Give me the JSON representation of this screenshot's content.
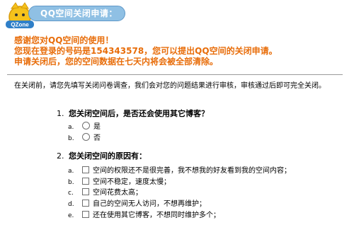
{
  "header": {
    "logo_text": "QZone",
    "title": "QQ空间关闭申请："
  },
  "notice": {
    "line1": "感谢您对QQ空间的使用！",
    "line2_prefix": "您现在登录的号码是",
    "qq_number": "154343578",
    "line2_suffix": "，您可以提出QQ空间的关闭申请。",
    "line3": "申请关闭后，您的空间数据在七天内将会被全部清除。"
  },
  "intro": "在关闭前，请您先填写关闭问卷调查，我们会对您的问题结果进行审核，审核通过后即可完全关闭。",
  "questions": [
    {
      "number": "1.",
      "text": "您关闭空间后，是否还会使用其它博客？",
      "options": [
        {
          "letter": "a.",
          "label": "是"
        },
        {
          "letter": "b.",
          "label": "否"
        }
      ]
    },
    {
      "number": "2.",
      "text": "您关闭空间的原因有：",
      "options": [
        {
          "letter": "a.",
          "label": "空间的权限还不是很完善，我不想我的好友看到我的空间内容；"
        },
        {
          "letter": "b.",
          "label": "空间不稳定，速度太慢；"
        },
        {
          "letter": "c.",
          "label": "空间花费太高；"
        },
        {
          "letter": "d.",
          "label": "自己的空间无人访问，不想再维护；"
        },
        {
          "letter": "e.",
          "label": "还在使用其它博客，不想同时维护多个；"
        }
      ]
    }
  ],
  "colors": {
    "notice": "#e86d0a",
    "title_bar": "#8fc0e4",
    "title_border": "#5f98c8"
  }
}
